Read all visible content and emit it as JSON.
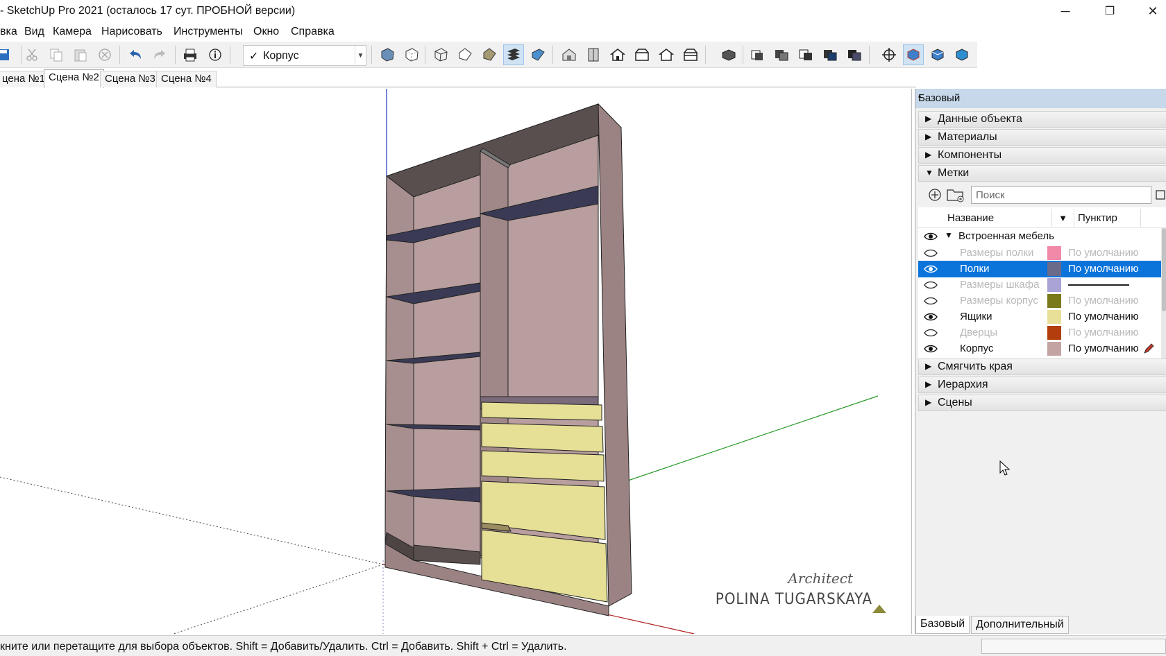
{
  "window": {
    "title": "- SketchUp Pro 2021 (осталось 17 сут. ПРОБНОЙ версии)",
    "minimize": "─",
    "restore": "❐",
    "close": "✕"
  },
  "menu": [
    "вка",
    "Вид",
    "Камера",
    "Нарисовать",
    "Инструменты",
    "Окно",
    "Справка"
  ],
  "toolbar": {
    "active_layer": "Корпус",
    "icons": [
      "save-icon",
      "cut-icon",
      "copy-icon",
      "paste-icon",
      "erase-icon",
      "undo-icon",
      "redo-icon",
      "print-icon",
      "model-info-icon",
      "xray-icon",
      "back-edges-icon",
      "wireframe-icon",
      "hidden-line-icon",
      "shaded-icon",
      "shaded-textures-icon",
      "monochrome-icon",
      "iso-view-icon",
      "top-view-icon",
      "front-view-icon",
      "right-view-icon",
      "back-view-icon",
      "left-view-icon",
      "union-icon",
      "outer-shell-icon",
      "intersect-icon",
      "subtract-icon",
      "trim-icon",
      "split-icon",
      "section-plane-icon",
      "display-section-planes-icon",
      "display-section-cuts-icon",
      "display-section-fill-icon"
    ]
  },
  "scenes": [
    "цена №1",
    "Сцена №2",
    "Сцена №3",
    "Сцена №4"
  ],
  "active_scene": "Сцена №2",
  "watermark": {
    "line1": "Architect",
    "line2": "POLINA TUGARSKAYA"
  },
  "tray": {
    "title": "Базовый",
    "sections_top": [
      "Данные объекта",
      "Материалы",
      "Компоненты"
    ],
    "tags_section": "Метки",
    "search_placeholder": "Поиск",
    "col_name": "Название",
    "col_dash": "Пунктир",
    "folder": "Встроенная мебель",
    "tags": [
      {
        "name": "Размеры полки",
        "color": "#f08aa8",
        "dash": "По умолчанию",
        "visible": false,
        "selected": false
      },
      {
        "name": "Полки",
        "color": "#6a6a8a",
        "dash": "По умолчанию",
        "visible": true,
        "selected": true
      },
      {
        "name": "Размеры шкафа",
        "color": "#a9a3d6",
        "dash": "",
        "visible": false,
        "selected": false
      },
      {
        "name": "Размеры корпус",
        "color": "#7a7a1a",
        "dash": "По умолчанию",
        "visible": false,
        "selected": false
      },
      {
        "name": "Ящики",
        "color": "#e8df98",
        "dash": "По умолчанию",
        "visible": true,
        "selected": false
      },
      {
        "name": "Дверцы",
        "color": "#b33d0c",
        "dash": "По умолчанию",
        "visible": false,
        "selected": false
      },
      {
        "name": "Корпус",
        "color": "#c4a3a3",
        "dash": "По умолчанию",
        "visible": true,
        "selected": false
      }
    ],
    "sections_bottom": [
      "Смягчить края",
      "Иерархия",
      "Сцены"
    ],
    "bottom_tabs": [
      "Базовый",
      "Дополнительный"
    ]
  },
  "status": {
    "text": "кните или перетащите для выбора объектов. Shift = Добавить/Удалить. Ctrl = Добавить. Shift + Ctrl = Удалить."
  }
}
